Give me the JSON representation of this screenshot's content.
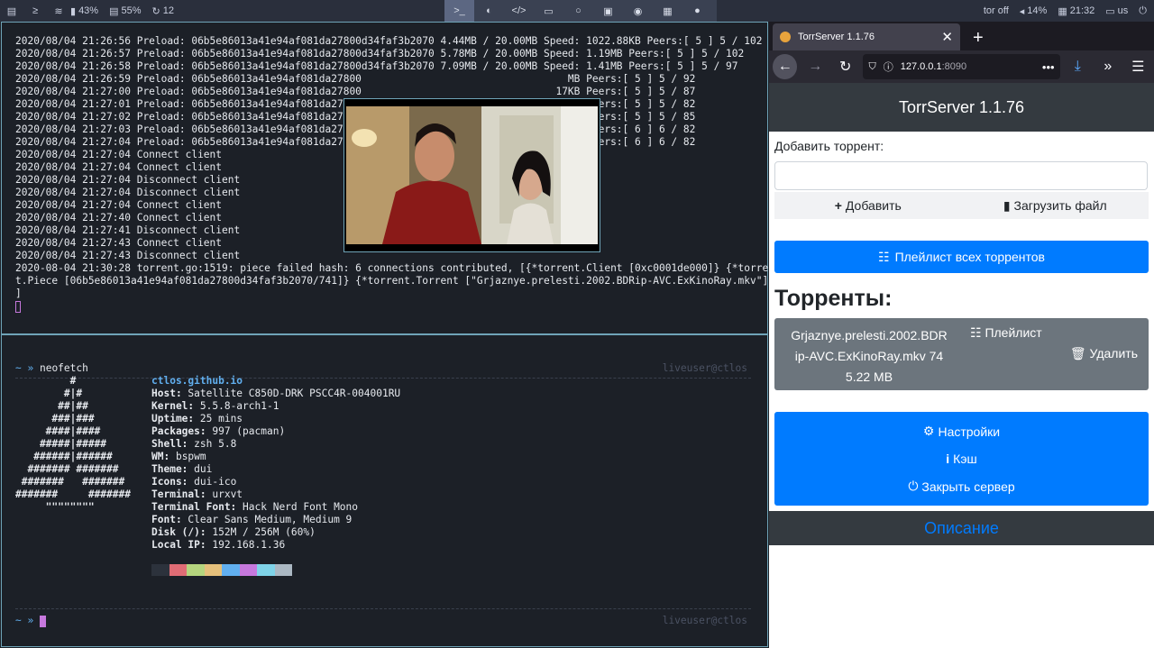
{
  "topbar": {
    "stats": {
      "battery": "43%",
      "brightness": "55%",
      "updates": "12"
    },
    "workspaces": [
      "terminal",
      "circle-half",
      "code",
      "folder",
      "chat",
      "image",
      "eye",
      "keyboard",
      "steam"
    ],
    "tor": "tor off",
    "volume": "14%",
    "clock": "21:32",
    "layout": "us"
  },
  "log": {
    "lines": [
      "2020/08/04 21:26:56 Preload: 06b5e86013a41e94af081da27800d34faf3b2070 4.44MB / 20.00MB Speed: 1022.88KB Peers:[ 5 ] 5 / 102",
      "2020/08/04 21:26:57 Preload: 06b5e86013a41e94af081da27800d34faf3b2070 5.78MB / 20.00MB Speed: 1.19MB Peers:[ 5 ] 5 / 102",
      "2020/08/04 21:26:58 Preload: 06b5e86013a41e94af081da27800d34faf3b2070 7.09MB / 20.00MB Speed: 1.41MB Peers:[ 5 ] 5 / 97",
      "2020/08/04 21:26:59 Preload: 06b5e86013a41e94af081da27800                                  MB Peers:[ 5 ] 5 / 92",
      "2020/08/04 21:27:00 Preload: 06b5e86013a41e94af081da27800                                17KB Peers:[ 5 ] 5 / 87",
      "2020/08/04 21:27:01 Preload: 06b5e86013a41e94af081da27800                                  MB Peers:[ 5 ] 5 / 82",
      "2020/08/04 21:27:02 Preload: 06b5e86013a41e94af081da27800                                  MB Peers:[ 5 ] 5 / 85",
      "2020/08/04 21:27:03 Preload: 06b5e86013a41e94af081da27800                                  MB Peers:[ 6 ] 6 / 82",
      "2020/08/04 21:27:04 Preload: 06b5e86013a41e94af081da27800                                  MB Peers:[ 6 ] 6 / 82",
      "2020/08/04 21:27:04 Connect client",
      "2020/08/04 21:27:04 Connect client",
      "2020/08/04 21:27:04 Disconnect client",
      "2020/08/04 21:27:04 Disconnect client",
      "2020/08/04 21:27:04 Connect client",
      "2020/08/04 21:27:40 Connect client",
      "2020/08/04 21:27:41 Disconnect client",
      "2020/08/04 21:27:43 Connect client",
      "2020/08/04 21:27:43 Disconnect client",
      "2020-08-04 21:30:28 torrent.go:1519: piece failed hash: 6 connections contributed, [{*torrent.Client [0xc0001de000]} {*torren",
      "t.Piece [06b5e86013a41e94af081da27800d34faf3b2070/741]} {*torrent.Torrent [\"Grjaznye.prelesti.2002.BDRip-AVC.ExKinoRay.mkv\"]}",
      "]"
    ]
  },
  "neofetch": {
    "prompt": "~ »",
    "command": "neofetch",
    "right_host": "liveuser@ctlos",
    "logo": [
      "         #",
      "        #|#",
      "       ##|##",
      "      ###|###",
      "     ####|####",
      "    #####|#####",
      "   ######|######",
      "  ####### #######",
      " #######   #######",
      "#######     #######",
      "     \"\"\"\"\"\"\"\""
    ],
    "title": "ctlos.github.io",
    "info": [
      {
        "k": "Host:",
        "v": " Satellite C850D-DRK PSCC4R-004001RU"
      },
      {
        "k": "Kernel:",
        "v": " 5.5.8-arch1-1"
      },
      {
        "k": "Uptime:",
        "v": " 25 mins"
      },
      {
        "k": "Packages:",
        "v": " 997 (pacman)"
      },
      {
        "k": "Shell:",
        "v": " zsh 5.8"
      },
      {
        "k": "WM:",
        "v": " bspwm"
      },
      {
        "k": "Theme:",
        "v": " dui"
      },
      {
        "k": "Icons:",
        "v": " dui-ico"
      },
      {
        "k": "Terminal:",
        "v": " urxvt"
      },
      {
        "k": "Terminal Font:",
        "v": " Hack Nerd Font Mono"
      },
      {
        "k": "Font:",
        "v": " Clear Sans Medium, Medium 9"
      },
      {
        "k": "Disk (/):",
        "v": " 152M / 256M (60%)"
      },
      {
        "k": "Local IP:",
        "v": " 192.168.1.36"
      }
    ],
    "palette": [
      "#2c323c",
      "#e06c75",
      "#b5d57e",
      "#e5c07b",
      "#61afef",
      "#c678dd",
      "#7fd3e8",
      "#abb8c3"
    ],
    "prompt2": "~ »",
    "right_host2": "liveuser@ctlos"
  },
  "browser": {
    "tab_title": "TorrServer 1.1.76",
    "url_host": "127.0.0.1",
    "url_port": ":8090",
    "page_header": "TorrServer 1.1.76",
    "add_label": "Добавить торрент:",
    "add_button": "Добавить",
    "upload_button": "Загрузить файл",
    "playlist_all": "Плейлист всех торрентов",
    "torrents_heading": "Торренты:",
    "torrent": {
      "name_l1": "Grjaznye.prelesti.2002.BDR",
      "name_l2": "ip-AVC.ExKinoRay.mkv 74",
      "name_l3": "5.22 MB",
      "playlist": "Плейлист",
      "delete": "Удалить"
    },
    "menu": {
      "settings": "Настройки",
      "cache": "Кэш",
      "shutdown": "Закрыть сервер"
    },
    "footer": "Описание"
  }
}
